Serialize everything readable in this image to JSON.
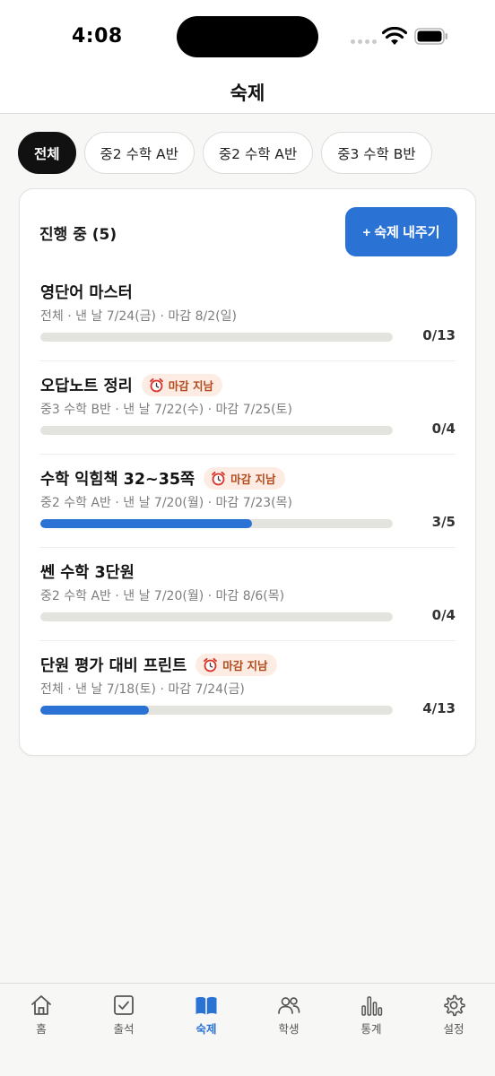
{
  "status_bar": {
    "time": "4:08"
  },
  "header": {
    "title": "숙제"
  },
  "filters": [
    {
      "label": "전체",
      "active": true
    },
    {
      "label": "중2 수학 A반",
      "active": false
    },
    {
      "label": "중2 수학 A반",
      "active": false
    },
    {
      "label": "중3 수학 B반",
      "active": false
    }
  ],
  "section": {
    "title": "진행 중 (5)",
    "assign_button": "+ 숙제 내주기"
  },
  "overdue_label": "마감 지남",
  "homework": [
    {
      "title": "영단어 마스터",
      "meta": "전체 · 낸 날 7/24(금) · 마감 8/2(일)",
      "overdue": false,
      "done": 0,
      "total": 13,
      "count": "0/13"
    },
    {
      "title": "오답노트 정리",
      "meta": "중3 수학 B반 · 낸 날 7/22(수) · 마감 7/25(토)",
      "overdue": true,
      "done": 0,
      "total": 4,
      "count": "0/4"
    },
    {
      "title": "수학 익힘책 32~35쪽",
      "meta": "중2 수학 A반 · 낸 날 7/20(월) · 마감 7/23(목)",
      "overdue": true,
      "done": 3,
      "total": 5,
      "count": "3/5"
    },
    {
      "title": "쎈 수학 3단원",
      "meta": "중2 수학 A반 · 낸 날 7/20(월) · 마감 8/6(목)",
      "overdue": false,
      "done": 0,
      "total": 4,
      "count": "0/4"
    },
    {
      "title": "단원 평가 대비 프린트",
      "meta": "전체 · 낸 날 7/18(토) · 마감 7/24(금)",
      "overdue": true,
      "done": 4,
      "total": 13,
      "count": "4/13"
    }
  ],
  "tabs": [
    {
      "label": "홈",
      "icon": "home-icon",
      "active": false
    },
    {
      "label": "출석",
      "icon": "attendance-check-icon",
      "active": false
    },
    {
      "label": "숙제",
      "icon": "book-icon",
      "active": true
    },
    {
      "label": "학생",
      "icon": "students-icon",
      "active": false
    },
    {
      "label": "통계",
      "icon": "bar-chart-icon",
      "active": false
    },
    {
      "label": "설정",
      "icon": "gear-icon",
      "active": false
    }
  ],
  "colors": {
    "accent": "#2a72d4",
    "overdue_bg": "#fdece4",
    "overdue_text": "#b24a1c",
    "track": "#e4e4df"
  }
}
